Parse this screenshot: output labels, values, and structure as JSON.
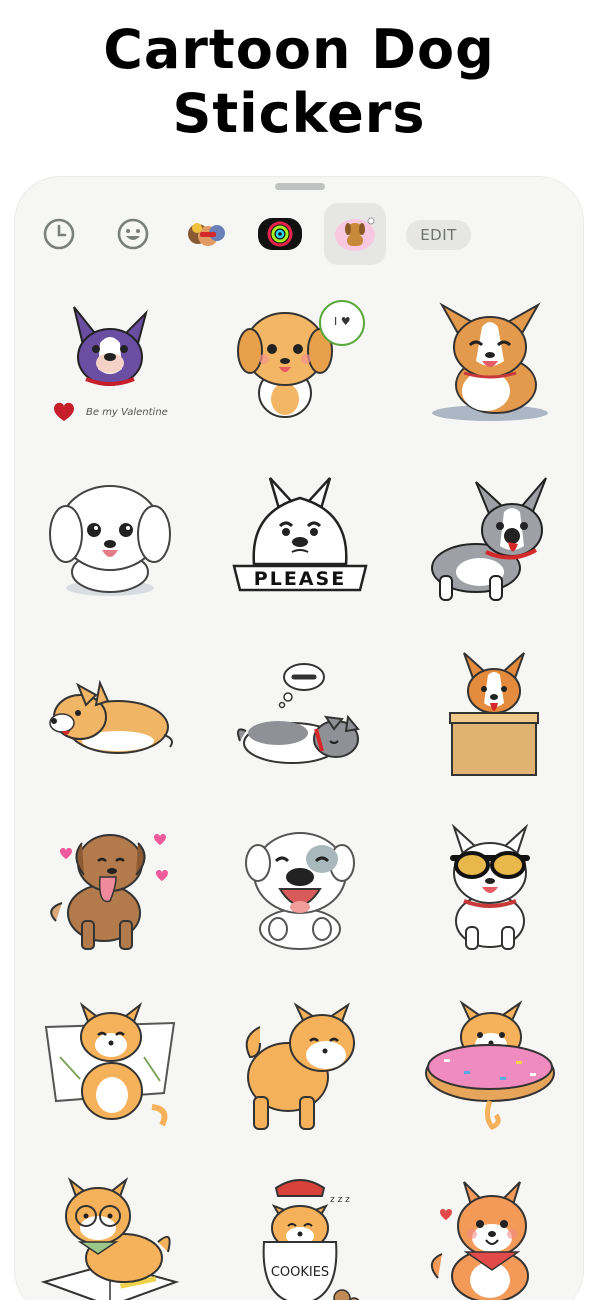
{
  "headline": {
    "line1": "Cartoon Dog",
    "line2": "Stickers"
  },
  "toolbar": {
    "items": [
      {
        "icon": "clock-icon",
        "label": "recents"
      },
      {
        "icon": "smiley-icon",
        "label": "emoji"
      },
      {
        "icon": "memoji-icon",
        "label": "memoji"
      },
      {
        "icon": "activity-rings-icon",
        "label": "activity"
      },
      {
        "icon": "dog-sticker-pack-icon",
        "label": "dog stickers",
        "selected": true
      }
    ],
    "edit_label": "EDIT"
  },
  "stickers": [
    {
      "name": "french-bulldog-valentine",
      "text": "Be my Valentine",
      "body": "#6a4ea2",
      "accent": "#c61e2a"
    },
    {
      "name": "golden-puppy-speech-bubble",
      "text": "I ♥",
      "body": "#f3b664",
      "accent": "#5aa83a"
    },
    {
      "name": "corgi-sitting",
      "body": "#e49a4d",
      "accent": "#c8393a"
    },
    {
      "name": "maltese-puppy",
      "body": "#ffffff",
      "accent": "#e37c86"
    },
    {
      "name": "samoyed-please-banner",
      "text": "PLEASE",
      "body": "#ffffff",
      "accent": "#111111"
    },
    {
      "name": "gray-corgi-tongue",
      "body": "#9ea0a6",
      "accent": "#d5282a"
    },
    {
      "name": "corgi-lying",
      "body": "#f0b565",
      "accent": "#d5282a"
    },
    {
      "name": "husky-sleeping-dreaming",
      "body": "#8f9196",
      "accent": "#d5282a"
    },
    {
      "name": "corgi-in-box",
      "body": "#e48b3e",
      "accent": "#e0b372"
    },
    {
      "name": "brown-dog-hearts",
      "body": "#b37a4c",
      "accent": "#f05b9b"
    },
    {
      "name": "white-dog-laughing",
      "body": "#ffffff",
      "accent": "#d95a5a"
    },
    {
      "name": "white-dog-sunglasses",
      "body": "#ffffff",
      "accent": "#e9b84a"
    },
    {
      "name": "shiba-on-pillow",
      "body": "#f6b25b",
      "accent": "#ffffff"
    },
    {
      "name": "shiba-looking-back",
      "body": "#f6b25b",
      "accent": "#ffffff"
    },
    {
      "name": "shiba-in-donut",
      "body": "#f6b25b",
      "accent": "#f08bbf"
    },
    {
      "name": "shiba-reading-book",
      "body": "#f6b25b",
      "accent": "#9cc78a"
    },
    {
      "name": "shiba-cookie-jar",
      "text": "COOKIES",
      "body": "#f6b25b",
      "accent": "#d8423a"
    },
    {
      "name": "shiba-bandana-heart",
      "body": "#f39a58",
      "accent": "#e24a4a"
    }
  ]
}
